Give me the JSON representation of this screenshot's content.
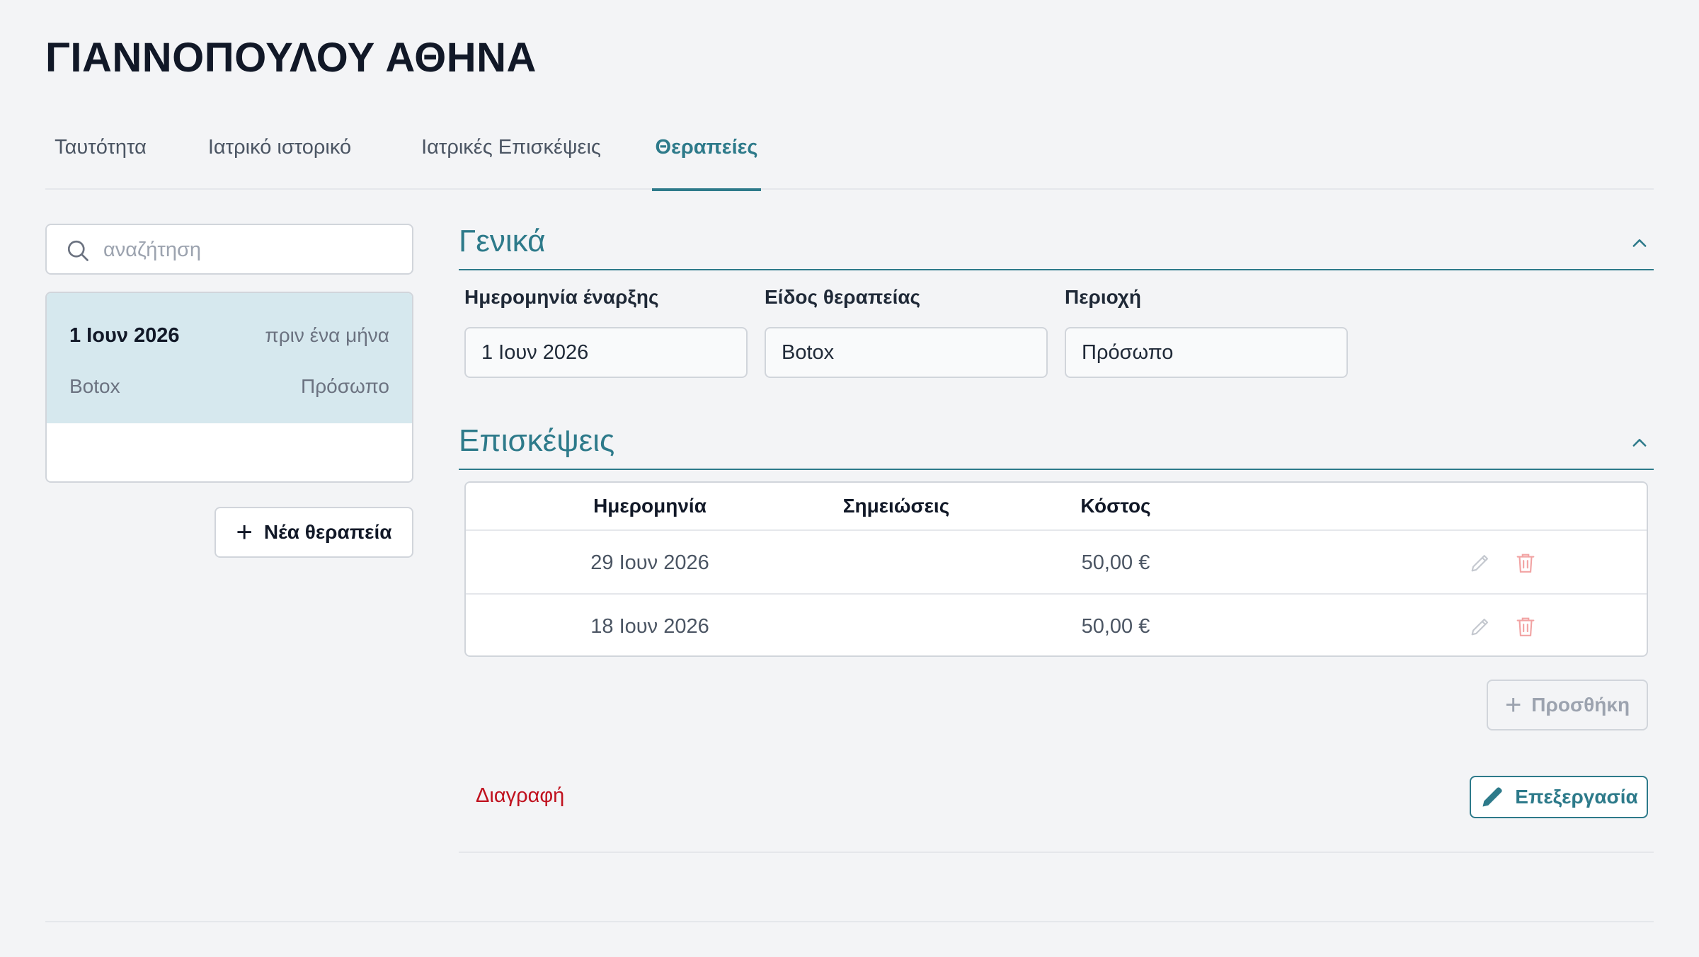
{
  "patient": {
    "name": "ΓΙΑΝΝΟΠΟΥΛΟΥ ΑΘΗΝΑ"
  },
  "tabs": [
    {
      "label": "Ταυτότητα",
      "active": false
    },
    {
      "label": "Ιατρικό ιστορικό",
      "active": false
    },
    {
      "label": "Ιατρικές Επισκέψεις",
      "active": false
    },
    {
      "label": "Θεραπείες",
      "active": true
    }
  ],
  "search": {
    "placeholder": "αναζήτηση",
    "value": ""
  },
  "therapies": [
    {
      "date": "1 Ιουν 2026",
      "relative": "πριν ένα μήνα",
      "type": "Botox",
      "area": "Πρόσωπο",
      "selected": true
    }
  ],
  "new_therapy_label": "Νέα θεραπεία",
  "general": {
    "title": "Γενικά",
    "fields": [
      {
        "label": "Ημερομηνία έναρξης",
        "value": "1 Ιουν 2026"
      },
      {
        "label": "Είδος θεραπείας",
        "value": "Botox"
      },
      {
        "label": "Περιοχή",
        "value": "Πρόσωπο"
      }
    ]
  },
  "visits": {
    "title": "Επισκέψεις",
    "columns": [
      "Ημερομηνία",
      "Σημειώσεις",
      "Κόστος"
    ],
    "rows": [
      {
        "date": "29 Ιουν 2026",
        "notes": "",
        "cost": "50,00 €"
      },
      {
        "date": "18 Ιουν 2026",
        "notes": "",
        "cost": "50,00 €"
      }
    ],
    "add_label": "Προσθήκη"
  },
  "actions": {
    "delete_label": "Διαγραφή",
    "edit_label": "Επεξεργασία"
  },
  "colors": {
    "accent": "#2d7a8a",
    "danger": "#c0121f",
    "selected_bg": "#d6e8ee",
    "background": "#f3f4f6"
  }
}
